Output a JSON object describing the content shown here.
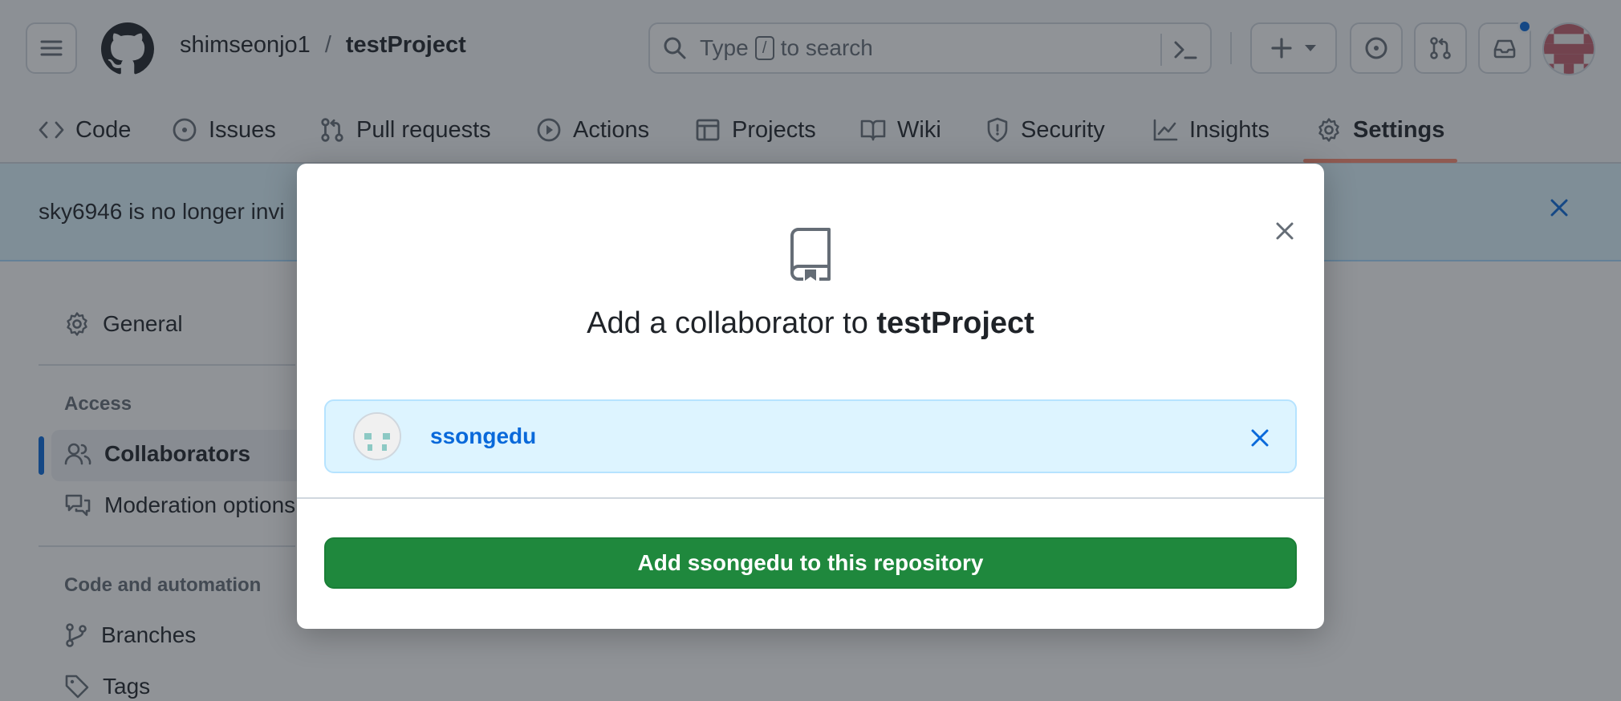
{
  "header": {
    "owner": "shimseonjo1",
    "separator": "/",
    "repo": "testProject",
    "search": {
      "prefix": "Type",
      "key": "/",
      "suffix": "to search"
    },
    "icons": [
      "menu-icon",
      "github-logo-icon",
      "search-icon",
      "command-palette-icon",
      "plus-icon",
      "triangle-down-icon",
      "issue-opened-icon",
      "git-pull-request-icon",
      "inbox-icon"
    ]
  },
  "repo_nav": {
    "tabs": [
      {
        "label": "Code",
        "icon": "code-icon"
      },
      {
        "label": "Issues",
        "icon": "issue-opened-icon"
      },
      {
        "label": "Pull requests",
        "icon": "git-pull-request-icon"
      },
      {
        "label": "Actions",
        "icon": "play-icon"
      },
      {
        "label": "Projects",
        "icon": "table-icon"
      },
      {
        "label": "Wiki",
        "icon": "book-icon"
      },
      {
        "label": "Security",
        "icon": "shield-icon"
      },
      {
        "label": "Insights",
        "icon": "graph-icon"
      },
      {
        "label": "Settings",
        "icon": "gear-icon"
      }
    ],
    "active": "Settings"
  },
  "flash": {
    "message": "sky6946 is no longer invi"
  },
  "sidebar": {
    "general": "General",
    "access_heading": "Access",
    "collaborators": "Collaborators",
    "moderation": "Moderation options",
    "code_automation_heading": "Code and automation",
    "branches": "Branches",
    "tags": "Tags"
  },
  "dialog": {
    "title_prefix": "Add a collaborator to",
    "title_repo": "testProject",
    "selected_user": "ssongedu",
    "add_button": "Add ssongedu to this repository"
  },
  "colors": {
    "primary_button": "#1f883d",
    "link": "#0969da",
    "selected_bg": "#ddf4ff",
    "active_tab_underline": "#fd8c73",
    "notification_dot": "#0969da"
  }
}
